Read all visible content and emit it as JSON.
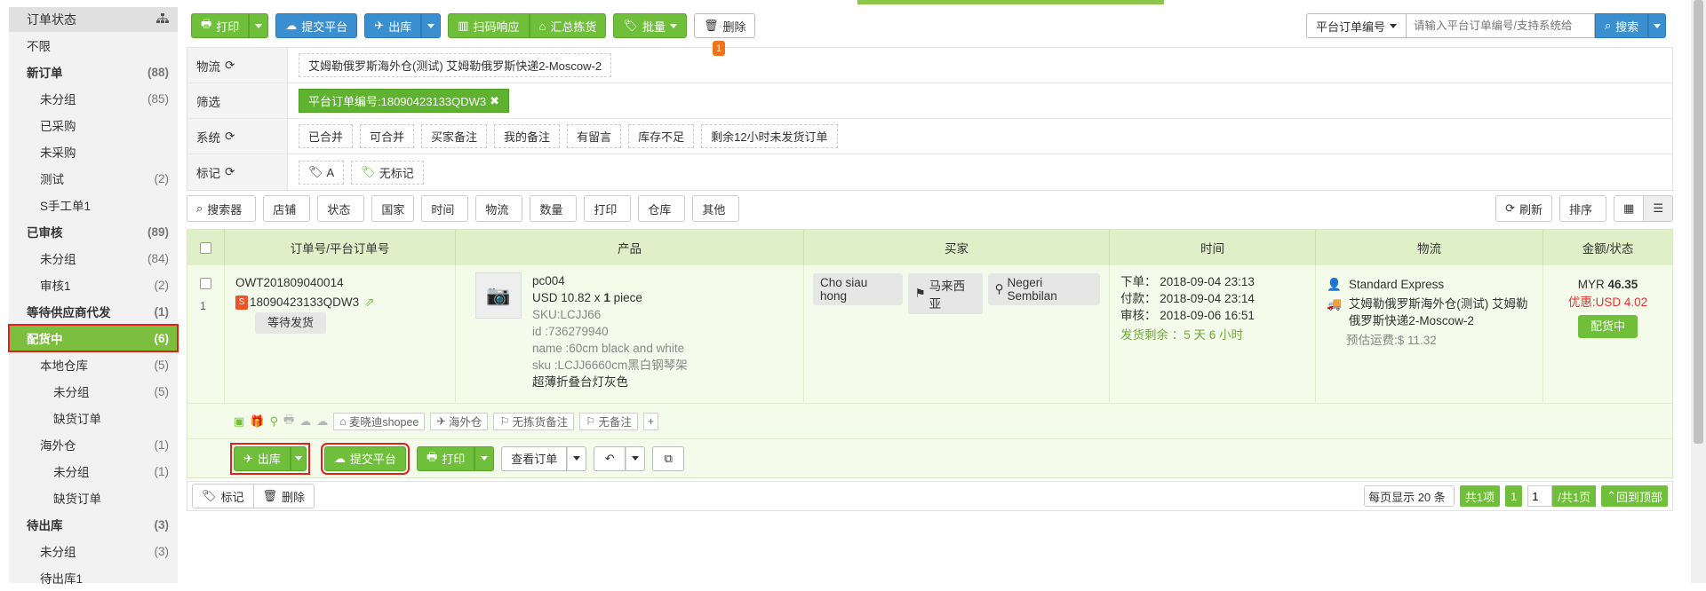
{
  "sidebar": {
    "header": "订单状态",
    "items": [
      {
        "label": "不限",
        "count": "",
        "level": 0,
        "bold": false
      },
      {
        "label": "新订单",
        "count": "(88)",
        "level": 0,
        "bold": true
      },
      {
        "label": "未分组",
        "count": "(85)",
        "level": 1,
        "bold": false
      },
      {
        "label": "已采购",
        "count": "",
        "level": 1,
        "bold": false
      },
      {
        "label": "未采购",
        "count": "",
        "level": 1,
        "bold": false
      },
      {
        "label": "测试",
        "count": "(2)",
        "level": 1,
        "bold": false
      },
      {
        "label": "S手工单1",
        "count": "",
        "level": 1,
        "bold": false
      },
      {
        "label": "已审核",
        "count": "(89)",
        "level": 0,
        "bold": true
      },
      {
        "label": "未分组",
        "count": "(84)",
        "level": 1,
        "bold": false
      },
      {
        "label": "审核1",
        "count": "(2)",
        "level": 1,
        "bold": false
      },
      {
        "label": "等待供应商代发",
        "count": "(1)",
        "level": 0,
        "bold": true
      },
      {
        "label": "配货中",
        "count": "(6)",
        "level": 0,
        "bold": true,
        "active": true
      },
      {
        "label": "本地仓库",
        "count": "(5)",
        "level": 1,
        "bold": false
      },
      {
        "label": "未分组",
        "count": "(5)",
        "level": 2,
        "bold": false
      },
      {
        "label": "缺货订单",
        "count": "",
        "level": 2,
        "bold": false
      },
      {
        "label": "海外仓",
        "count": "(1)",
        "level": 1,
        "bold": false
      },
      {
        "label": "未分组",
        "count": "(1)",
        "level": 2,
        "bold": false
      },
      {
        "label": "缺货订单",
        "count": "",
        "level": 2,
        "bold": false
      },
      {
        "label": "待出库",
        "count": "(3)",
        "level": 0,
        "bold": true
      },
      {
        "label": "未分组",
        "count": "(3)",
        "level": 1,
        "bold": false
      },
      {
        "label": "待出库1",
        "count": "",
        "level": 1,
        "bold": false
      }
    ]
  },
  "toolbar": {
    "print": "打印",
    "submit_platform": "提交平台",
    "outbound": "出库",
    "scan": "扫码响应",
    "summary_pick": "汇总拣货",
    "batch": "批量",
    "delete": "删除",
    "search_type": "平台订单编号",
    "search_placeholder": "请输入平台订单编号/支持系统给",
    "search": "搜索"
  },
  "filters": {
    "logistics_label": "物流",
    "logistics_value": "艾姆勒俄罗斯海外仓(测试) 艾姆勒俄罗斯快递2-Moscow-2",
    "logistics_badge": "1",
    "screen_label": "筛选",
    "screen_value": "平台订单编号:18090423133QDW3",
    "system_label": "系统",
    "system_items": [
      "已合并",
      "可合并",
      "买家备注",
      "我的备注",
      "有留言",
      "库存不足",
      "剩余12小时未发货订单"
    ],
    "mark_label": "标记",
    "mark_items": [
      "A",
      "无标记"
    ]
  },
  "toolbar2": {
    "items": [
      "搜索器",
      "店铺",
      "状态",
      "国家",
      "时间",
      "物流",
      "数量",
      "打印",
      "仓库",
      "其他"
    ],
    "refresh": "刷新",
    "sort": "排序"
  },
  "table": {
    "headers": [
      "订单号/平台订单号",
      "产品",
      "买家",
      "时间",
      "物流",
      "金额/状态"
    ],
    "order": {
      "order_no": "OWT201809040014",
      "row_index": "1",
      "platform_no": "18090423133QDW3",
      "status_tag": "等待发货",
      "product_name": "pc004",
      "product_price": "USD 10.82 x",
      "product_qty": "1",
      "product_unit": "piece",
      "sku": "SKU:LCJJ66",
      "pid": "id :736279940",
      "name_attr": "name :60cm black and white",
      "sku_attr": "sku :LCJJ6660cm黑白钢琴架",
      "title": "超薄折叠台灯灰色",
      "buyer_name": "Cho siau hong",
      "buyer_country": "马来西亚",
      "buyer_state": "Negeri Sembilan",
      "time_order": "下单： 2018-09-04 23:13",
      "time_pay": "付款： 2018-09-04 23:14",
      "time_audit": "审核： 2018-09-06 16:51",
      "time_left": "发货剩余 ：5 天 6 小时",
      "shipping": "Standard Express",
      "warehouse": "艾姆勒俄罗斯海外仓(测试) 艾姆勒俄罗斯快递2-Moscow-2",
      "freight": "预估运费:$ 11.32",
      "amount_prefix": "MYR",
      "amount": "46.35",
      "discount": "优惠:USD 4.02",
      "order_status": "配货中",
      "shop_tag": "麦晓迪shopee",
      "wh_tag": "海外仓",
      "no_pick_note": "无拣货备注",
      "no_note": "无备注",
      "act_outbound": "出库",
      "act_submit": "提交平台",
      "act_print": "打印",
      "act_view": "查看订单"
    }
  },
  "bottom": {
    "mark": "标记",
    "delete": "删除",
    "page_size": "每页显示 20 条",
    "total": "共1项",
    "page": "1",
    "page_input": "1",
    "total_pages": "/共1页",
    "back_top": "回到顶部"
  }
}
